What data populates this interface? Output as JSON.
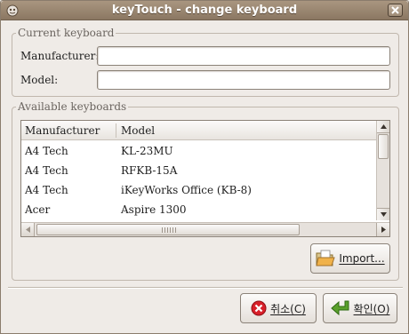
{
  "window": {
    "title": "keyTouch - change keyboard"
  },
  "current_keyboard": {
    "legend": "Current keyboard",
    "manufacturer_label": "Manufacturer:",
    "manufacturer_value": "",
    "model_label": "Model:",
    "model_value": ""
  },
  "available_keyboards": {
    "legend": "Available keyboards",
    "columns": [
      "Manufacturer",
      "Model"
    ],
    "rows": [
      {
        "manufacturer": "A4 Tech",
        "model": "KL-23MU"
      },
      {
        "manufacturer": "A4 Tech",
        "model": "RFKB-15A"
      },
      {
        "manufacturer": "A4 Tech",
        "model": "iKeyWorks Office (KB-8)"
      },
      {
        "manufacturer": "Acer",
        "model": "Aspire 1300"
      }
    ]
  },
  "buttons": {
    "import_label": "Import...",
    "cancel_label": "취소(C)",
    "ok_label": "확인(O)"
  },
  "icons": {
    "app": "keytouch-app-icon",
    "close": "close-icon",
    "import": "folder-open-icon",
    "cancel": "cancel-icon",
    "ok": "enter-arrow-icon"
  },
  "colors": {
    "titlebar": "#9b8770",
    "window_bg": "#efebe7",
    "cancel_red": "#d8202a",
    "ok_green": "#5aa02c"
  }
}
